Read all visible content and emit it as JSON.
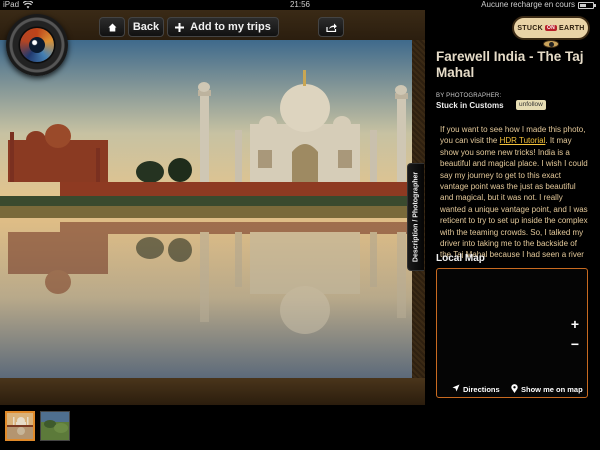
{
  "status_bar": {
    "device": "iPad",
    "time": "21:56",
    "charging_text": "Aucune recharge en cours"
  },
  "toolbar": {
    "back_label": "Back",
    "add_to_trips_label": "Add to my trips"
  },
  "side_tab": {
    "label": "Description / Photographer"
  },
  "info": {
    "brand_left": "STUCK",
    "brand_on": "ON",
    "brand_right": "EARTH",
    "title": "Farewell India - The Taj Mahal",
    "by_label": "BY PHOTOGRAPHER:",
    "photographer": "Stuck in Customs",
    "unfollow_label": "unfollow",
    "description_before_link": "If you want to see how I made this photo, you can visit the ",
    "description_link": "HDR Tutorial",
    "description_after_link": ". It may show you some new tricks! India is a beautiful and magical place. I wish I could say my journey to get to this exact vantage point was the just as beautiful and magical, but it was not. I really wanted a unique vantage point, and I was reticent to try to set up inside the complex with the teaming crowds. So, I talked my driver into taking me to the backside of the Taj Mahal because I had seen a river back there on Google Maps. We started"
  },
  "map": {
    "heading": "Local Map",
    "zoom_in": "+",
    "zoom_out": "−",
    "directions_label": "Directions",
    "show_on_map_label": "Show me on map"
  },
  "colors": {
    "accent_orange": "#c86a20",
    "title_text": "#e6dcc8",
    "description_text": "#e4c99a",
    "link": "#f4c23b"
  },
  "icons": [
    "wifi-icon",
    "battery-icon",
    "camera-lens-logo",
    "home-icon",
    "plus-icon",
    "share-icon",
    "location-arrow-icon",
    "map-pin-icon"
  ]
}
